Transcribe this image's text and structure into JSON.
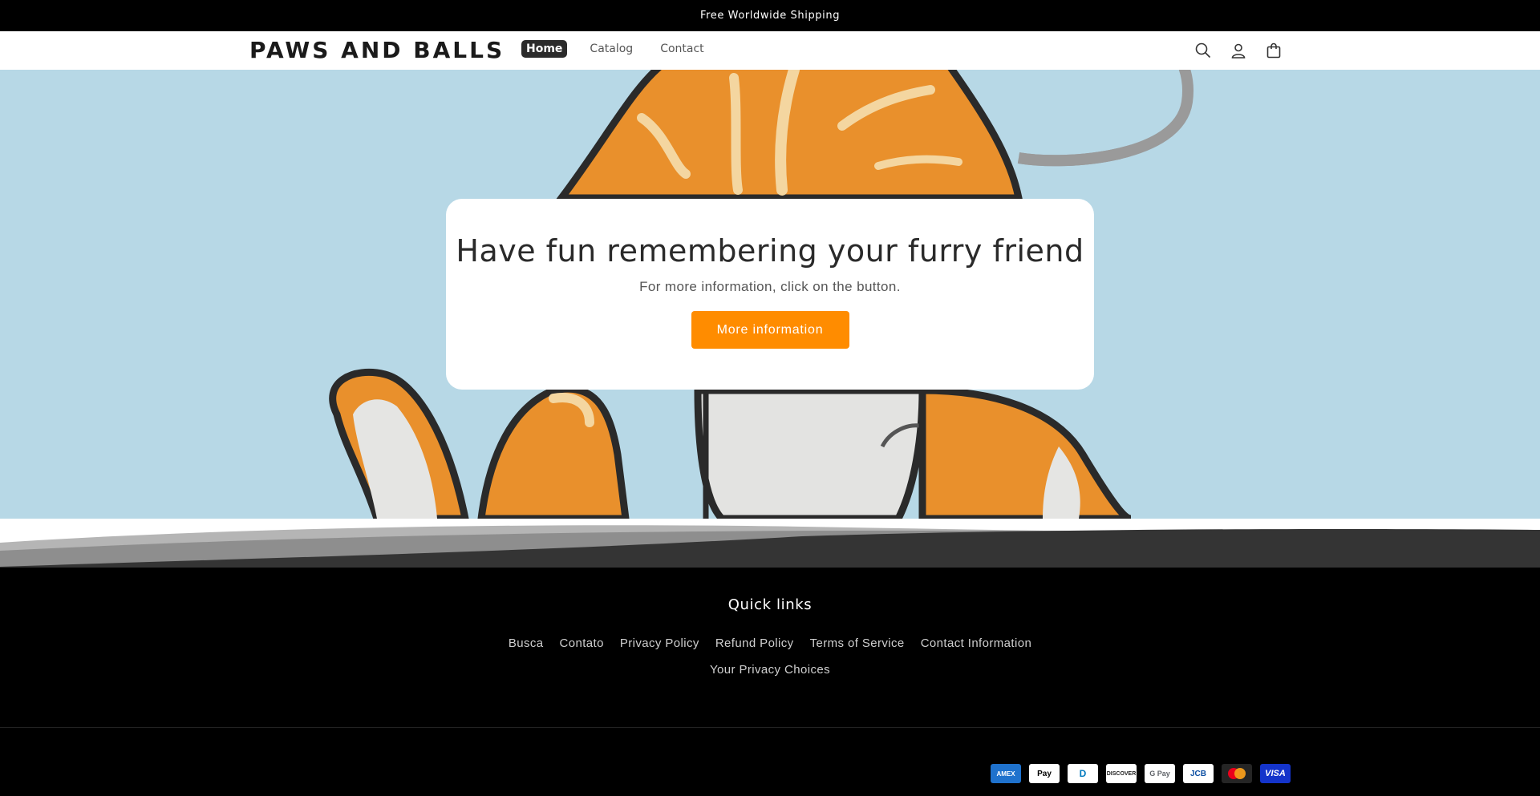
{
  "announcement": {
    "text": "Free Worldwide Shipping"
  },
  "header": {
    "logo": "PAWS AND BALLS",
    "nav": [
      "Home",
      "Catalog",
      "Contact"
    ],
    "icons": [
      "search-icon",
      "account-icon",
      "cart-icon"
    ]
  },
  "hero": {
    "title": "Have fun remembering your furry friend",
    "subtitle": "For more information, click on the button.",
    "button": "More information",
    "button_color": "#ff8c00",
    "background_color": "#b7d8e6"
  },
  "footer": {
    "heading": "Quick links",
    "links": [
      "Busca",
      "Contato",
      "Privacy Policy",
      "Refund Policy",
      "Terms of Service",
      "Contact Information",
      "Your Privacy Choices"
    ],
    "payments": [
      {
        "name": "American Express",
        "label": "AMEX"
      },
      {
        "name": "Apple Pay",
        "label": "Pay"
      },
      {
        "name": "Diners Club",
        "label": "D"
      },
      {
        "name": "Discover",
        "label": "DISCOVER"
      },
      {
        "name": "Google Pay",
        "label": "G Pay"
      },
      {
        "name": "JCB",
        "label": "JCB"
      },
      {
        "name": "Mastercard",
        "label": ""
      },
      {
        "name": "Visa",
        "label": "VISA"
      }
    ]
  }
}
